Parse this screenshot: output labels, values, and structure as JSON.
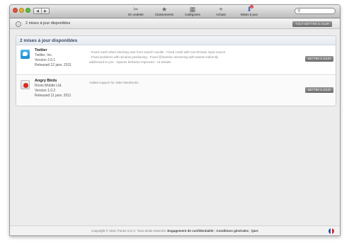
{
  "toolbar": {
    "back_glyph": "◀",
    "forward_glyph": "▶",
    "items": [
      {
        "label": "En vedette",
        "icon": "featured-icon",
        "glyph": "✂"
      },
      {
        "label": "Classements",
        "icon": "star-icon",
        "glyph": "★"
      },
      {
        "label": "Catégories",
        "icon": "categories-icon",
        "glyph": "▦"
      },
      {
        "label": "Achats",
        "icon": "purchases-icon",
        "glyph": "⌖"
      },
      {
        "label": "Mises à jour",
        "icon": "updates-icon",
        "glyph": "⬇",
        "badge": "2",
        "active": true
      }
    ],
    "search_glyph": "⚲",
    "search_placeholder": ""
  },
  "header": {
    "download_glyph": "↓",
    "title": "2 mises à jour disponibles",
    "update_all_label": "TOUT METTRE À JOUR"
  },
  "panel": {
    "title": "2 mises à jour disponibles"
  },
  "apps": [
    {
      "name": "Twitter",
      "developer": "Twitter, Inc.",
      "version": "Version 2.0.1",
      "released": "Released 12 janv. 2011",
      "notes": "- Fixed crash when blocking user from search results - Fixed crash with non-Roman input source - Fixed problems with window positioning - Fixed @mention streaming with tweets indirectly addressed to you - Spaces behavior improved - UI tweaks",
      "button_label": "METTRE À JOUR"
    },
    {
      "name": "Angry Birds",
      "developer": "Rovio Mobile Ltd.",
      "version": "Version 1.0.2",
      "released": "Released 11 janv. 2011",
      "notes": "Added support for older MacBooks.",
      "button_label": "METTRE À JOUR"
    }
  ],
  "footer": {
    "copyright": "Copyright © 2011 iTunes S.à r.l. Tous droits réservés.",
    "privacy": "Engagement de confidentialité",
    "terms": "Conditions générales",
    "faq": "Q&A",
    "separator": "|"
  },
  "colors": {
    "flag": [
      "#2b4fa8",
      "#ffffff",
      "#d62a2a"
    ],
    "badge": "#dd3333",
    "accent": "#3a6fb5"
  }
}
